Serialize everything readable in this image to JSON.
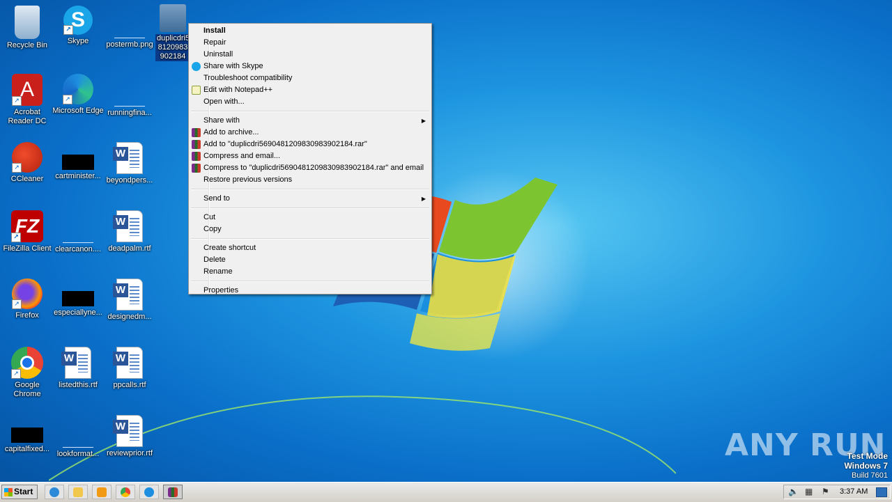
{
  "desktop_icons": [
    {
      "label": "Recycle Bin",
      "icon": "recycle-bin-icon"
    },
    {
      "label": "Skype",
      "icon": "skype-icon"
    },
    {
      "label": "postermb.png",
      "icon": "image-file-icon"
    },
    {
      "label": "duplicdri5 8120983 902184",
      "icon": "installer-icon"
    },
    {
      "label": "Acrobat Reader DC",
      "icon": "acrobat-icon"
    },
    {
      "label": "Microsoft Edge",
      "icon": "edge-icon"
    },
    {
      "label": "runningfina...",
      "icon": "file-icon"
    },
    {
      "label": "CCleaner",
      "icon": "ccleaner-icon"
    },
    {
      "label": "cartminister...",
      "icon": "file-icon"
    },
    {
      "label": "beyondpers...",
      "icon": "word-doc-icon"
    },
    {
      "label": "FileZilla Client",
      "icon": "filezilla-icon"
    },
    {
      "label": "clearcanon....",
      "icon": "file-icon"
    },
    {
      "label": "deadpalm.rtf",
      "icon": "word-doc-icon"
    },
    {
      "label": "Firefox",
      "icon": "firefox-icon"
    },
    {
      "label": "especiallyne...",
      "icon": "file-icon"
    },
    {
      "label": "designedm...",
      "icon": "word-doc-icon"
    },
    {
      "label": "Google Chrome",
      "icon": "chrome-icon"
    },
    {
      "label": "listedthis.rtf",
      "icon": "word-doc-icon"
    },
    {
      "label": "ppcalls.rtf",
      "icon": "word-doc-icon"
    },
    {
      "label": "capitalfixed...",
      "icon": "file-icon"
    },
    {
      "label": "lookformat...",
      "icon": "file-icon"
    },
    {
      "label": "reviewprior.rtf",
      "icon": "word-doc-icon"
    }
  ],
  "context_menu": {
    "items": [
      {
        "label": "Install",
        "bold": true
      },
      {
        "label": "Repair"
      },
      {
        "label": "Uninstall"
      },
      {
        "label": "Share with Skype",
        "icon": "skype-icon"
      },
      {
        "label": "Troubleshoot compatibility"
      },
      {
        "label": "Edit with Notepad++",
        "icon": "notepadpp-icon"
      },
      {
        "label": "Open with..."
      },
      {
        "label": "Share with",
        "submenu": true
      },
      {
        "label": "Add to archive...",
        "icon": "winrar-icon"
      },
      {
        "label": "Add to \"duplicdri569048120983098390218 4.rar\""
      },
      {
        "label": "Compress and email...",
        "icon": "winrar-icon"
      },
      {
        "label": "Compress to \"duplicdri569048120983098390218 4.rar\" and email",
        "icon": "winrar-icon"
      },
      {
        "label": "Restore previous versions"
      },
      {
        "label": "Send to",
        "submenu": true
      },
      {
        "label": "Cut"
      },
      {
        "label": "Copy"
      },
      {
        "label": "Create shortcut"
      },
      {
        "label": "Delete"
      },
      {
        "label": "Rename"
      },
      {
        "label": "Properties"
      }
    ],
    "add_to_rar": "Add to \"duplicdri5690481209830983902184.rar\"",
    "compress_to_rar_email": "Compress to \"duplicdri5690481209830983902184.rar\" and email"
  },
  "taskbar": {
    "start_label": "Start",
    "clock": "3:37 AM",
    "pinned": [
      "ie-icon",
      "explorer-icon",
      "media-player-icon",
      "chrome-icon",
      "edge-icon",
      "winrar-icon"
    ]
  },
  "watermark": {
    "brand": "ANY RUN",
    "test_mode": "Test Mode",
    "os": "Windows 7",
    "build": "Build 7601"
  }
}
